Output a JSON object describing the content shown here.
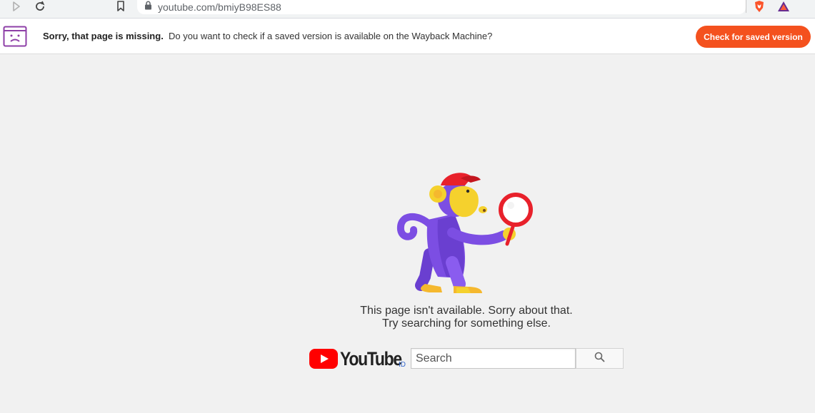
{
  "browser": {
    "url": "youtube.com/bmiyB98ES88"
  },
  "banner": {
    "title": "Sorry, that page is missing.",
    "message": "Do you want to check if a saved version is available on the Wayback Machine?",
    "button_label": "Check for saved version"
  },
  "error": {
    "line1": "This page isn't available. Sorry about that.",
    "line2": "Try searching for something else."
  },
  "logo": {
    "wordmark": "YouTube",
    "region": "ID"
  },
  "search": {
    "placeholder": "Search"
  },
  "colors": {
    "banner_button": "#f4511e",
    "youtube_red": "#ff0000",
    "monkey_purple": "#7c4ee3",
    "monkey_yellow": "#f5d12d"
  }
}
